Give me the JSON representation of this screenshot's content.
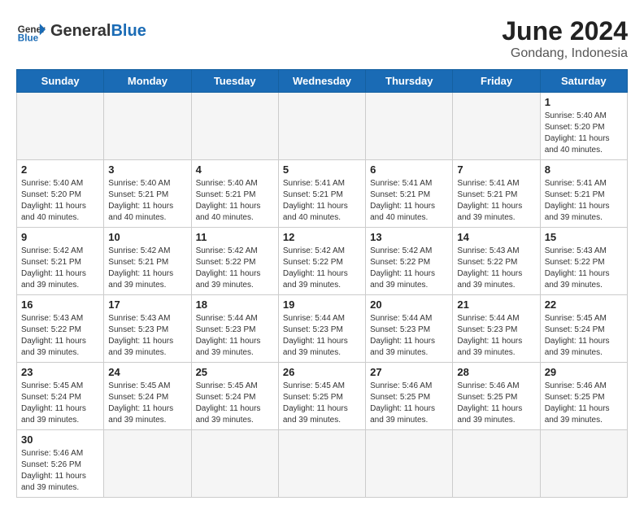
{
  "header": {
    "logo_general": "General",
    "logo_blue": "Blue",
    "title": "June 2024",
    "location": "Gondang, Indonesia"
  },
  "days_of_week": [
    "Sunday",
    "Monday",
    "Tuesday",
    "Wednesday",
    "Thursday",
    "Friday",
    "Saturday"
  ],
  "weeks": [
    [
      {
        "day": "",
        "info": ""
      },
      {
        "day": "",
        "info": ""
      },
      {
        "day": "",
        "info": ""
      },
      {
        "day": "",
        "info": ""
      },
      {
        "day": "",
        "info": ""
      },
      {
        "day": "",
        "info": ""
      },
      {
        "day": "1",
        "info": "Sunrise: 5:40 AM\nSunset: 5:20 PM\nDaylight: 11 hours and 40 minutes."
      }
    ],
    [
      {
        "day": "2",
        "info": "Sunrise: 5:40 AM\nSunset: 5:20 PM\nDaylight: 11 hours and 40 minutes."
      },
      {
        "day": "3",
        "info": "Sunrise: 5:40 AM\nSunset: 5:21 PM\nDaylight: 11 hours and 40 minutes."
      },
      {
        "day": "4",
        "info": "Sunrise: 5:40 AM\nSunset: 5:21 PM\nDaylight: 11 hours and 40 minutes."
      },
      {
        "day": "5",
        "info": "Sunrise: 5:41 AM\nSunset: 5:21 PM\nDaylight: 11 hours and 40 minutes."
      },
      {
        "day": "6",
        "info": "Sunrise: 5:41 AM\nSunset: 5:21 PM\nDaylight: 11 hours and 40 minutes."
      },
      {
        "day": "7",
        "info": "Sunrise: 5:41 AM\nSunset: 5:21 PM\nDaylight: 11 hours and 39 minutes."
      },
      {
        "day": "8",
        "info": "Sunrise: 5:41 AM\nSunset: 5:21 PM\nDaylight: 11 hours and 39 minutes."
      }
    ],
    [
      {
        "day": "9",
        "info": "Sunrise: 5:42 AM\nSunset: 5:21 PM\nDaylight: 11 hours and 39 minutes."
      },
      {
        "day": "10",
        "info": "Sunrise: 5:42 AM\nSunset: 5:21 PM\nDaylight: 11 hours and 39 minutes."
      },
      {
        "day": "11",
        "info": "Sunrise: 5:42 AM\nSunset: 5:22 PM\nDaylight: 11 hours and 39 minutes."
      },
      {
        "day": "12",
        "info": "Sunrise: 5:42 AM\nSunset: 5:22 PM\nDaylight: 11 hours and 39 minutes."
      },
      {
        "day": "13",
        "info": "Sunrise: 5:42 AM\nSunset: 5:22 PM\nDaylight: 11 hours and 39 minutes."
      },
      {
        "day": "14",
        "info": "Sunrise: 5:43 AM\nSunset: 5:22 PM\nDaylight: 11 hours and 39 minutes."
      },
      {
        "day": "15",
        "info": "Sunrise: 5:43 AM\nSunset: 5:22 PM\nDaylight: 11 hours and 39 minutes."
      }
    ],
    [
      {
        "day": "16",
        "info": "Sunrise: 5:43 AM\nSunset: 5:22 PM\nDaylight: 11 hours and 39 minutes."
      },
      {
        "day": "17",
        "info": "Sunrise: 5:43 AM\nSunset: 5:23 PM\nDaylight: 11 hours and 39 minutes."
      },
      {
        "day": "18",
        "info": "Sunrise: 5:44 AM\nSunset: 5:23 PM\nDaylight: 11 hours and 39 minutes."
      },
      {
        "day": "19",
        "info": "Sunrise: 5:44 AM\nSunset: 5:23 PM\nDaylight: 11 hours and 39 minutes."
      },
      {
        "day": "20",
        "info": "Sunrise: 5:44 AM\nSunset: 5:23 PM\nDaylight: 11 hours and 39 minutes."
      },
      {
        "day": "21",
        "info": "Sunrise: 5:44 AM\nSunset: 5:23 PM\nDaylight: 11 hours and 39 minutes."
      },
      {
        "day": "22",
        "info": "Sunrise: 5:45 AM\nSunset: 5:24 PM\nDaylight: 11 hours and 39 minutes."
      }
    ],
    [
      {
        "day": "23",
        "info": "Sunrise: 5:45 AM\nSunset: 5:24 PM\nDaylight: 11 hours and 39 minutes."
      },
      {
        "day": "24",
        "info": "Sunrise: 5:45 AM\nSunset: 5:24 PM\nDaylight: 11 hours and 39 minutes."
      },
      {
        "day": "25",
        "info": "Sunrise: 5:45 AM\nSunset: 5:24 PM\nDaylight: 11 hours and 39 minutes."
      },
      {
        "day": "26",
        "info": "Sunrise: 5:45 AM\nSunset: 5:25 PM\nDaylight: 11 hours and 39 minutes."
      },
      {
        "day": "27",
        "info": "Sunrise: 5:46 AM\nSunset: 5:25 PM\nDaylight: 11 hours and 39 minutes."
      },
      {
        "day": "28",
        "info": "Sunrise: 5:46 AM\nSunset: 5:25 PM\nDaylight: 11 hours and 39 minutes."
      },
      {
        "day": "29",
        "info": "Sunrise: 5:46 AM\nSunset: 5:25 PM\nDaylight: 11 hours and 39 minutes."
      }
    ],
    [
      {
        "day": "30",
        "info": "Sunrise: 5:46 AM\nSunset: 5:26 PM\nDaylight: 11 hours and 39 minutes."
      },
      {
        "day": "",
        "info": ""
      },
      {
        "day": "",
        "info": ""
      },
      {
        "day": "",
        "info": ""
      },
      {
        "day": "",
        "info": ""
      },
      {
        "day": "",
        "info": ""
      },
      {
        "day": "",
        "info": ""
      }
    ]
  ]
}
